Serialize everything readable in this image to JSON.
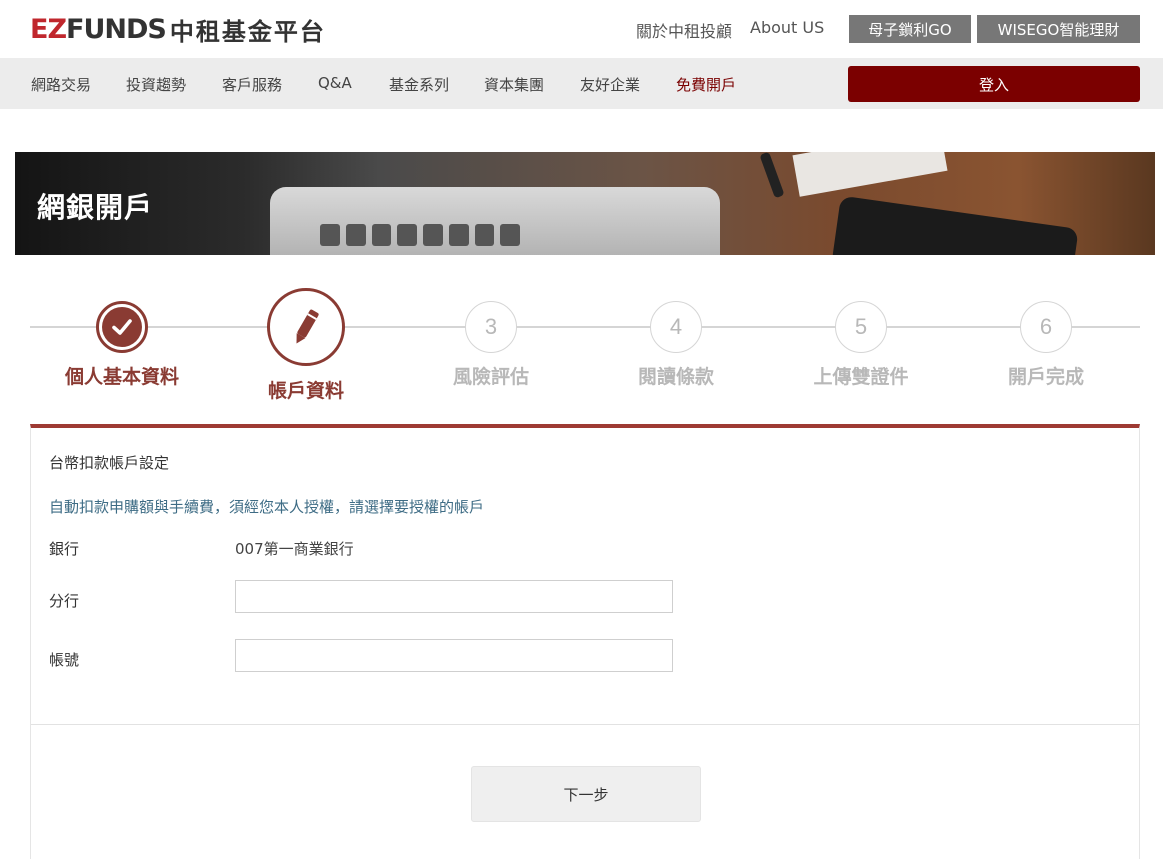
{
  "header": {
    "logo_ez": "EZ",
    "logo_funds": "FUNDS",
    "logo_cn": "中租基金平台",
    "links": {
      "about_cn": "關於中租投顧",
      "about_en": "About US"
    },
    "buttons": {
      "go": "母子鎖利GO",
      "wisego": "WISEGO智能理財"
    }
  },
  "nav": {
    "items": [
      "網路交易",
      "投資趨勢",
      "客戶服務",
      "Q&A",
      "基金系列",
      "資本集團",
      "友好企業",
      "免費開戶"
    ],
    "login": "登入",
    "highlight_color": "#7a0000"
  },
  "banner": {
    "title": "網銀開戶"
  },
  "steps": [
    {
      "label": "個人基本資料",
      "state": "done",
      "icon": "check-icon"
    },
    {
      "label": "帳戶資料",
      "state": "active",
      "icon": "pencil-icon"
    },
    {
      "number": "3",
      "label": "風險評估",
      "state": "todo"
    },
    {
      "number": "4",
      "label": "閱讀條款",
      "state": "todo"
    },
    {
      "number": "5",
      "label": "上傳雙證件",
      "state": "todo"
    },
    {
      "number": "6",
      "label": "開戶完成",
      "state": "todo"
    }
  ],
  "form": {
    "title": "台幣扣款帳戶設定",
    "note": "自動扣款申購額與手續費，須經您本人授權，請選擇要授權的帳戶",
    "bank_label": "銀行",
    "bank_value": "007第一商業銀行",
    "branch_label": "分行",
    "branch_value": "",
    "account_label": "帳號",
    "account_value": "",
    "next_label": "下一步"
  },
  "colors": {
    "accent": "#8a3b33",
    "login_bg": "#7b0000",
    "note_text": "#3e6c85"
  }
}
